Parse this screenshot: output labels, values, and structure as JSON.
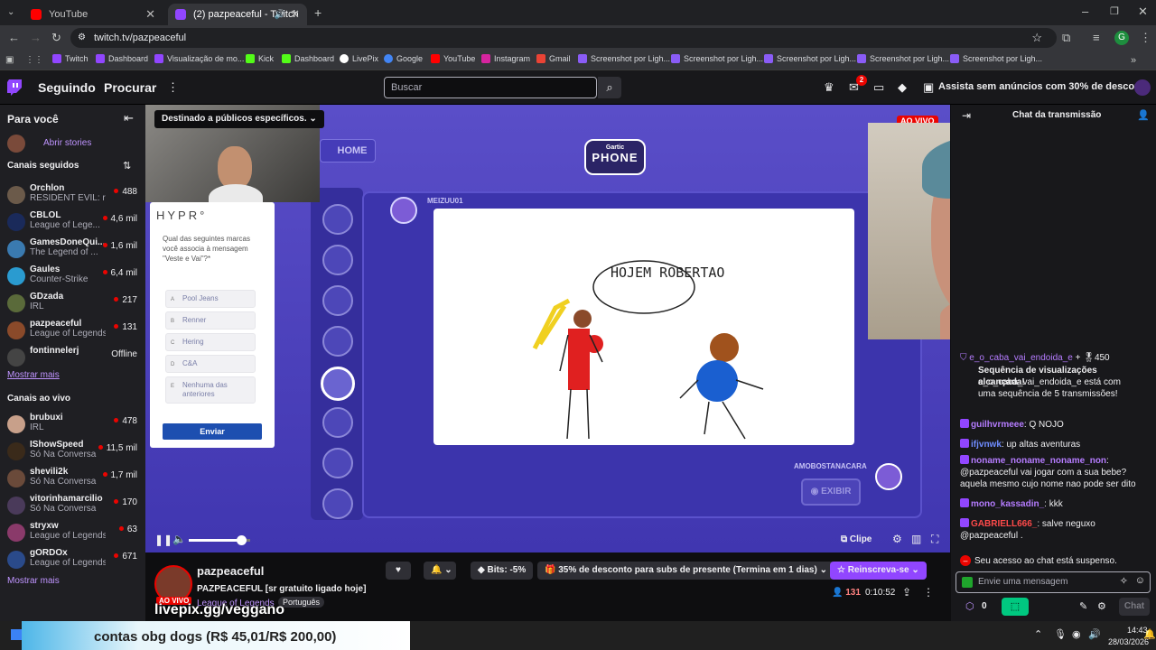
{
  "browser": {
    "tabs": [
      {
        "title": "YouTube",
        "color": "#ff0000"
      },
      {
        "title": "(2) pazpeaceful - Twitch",
        "color": "#9146ff"
      }
    ],
    "url": "twitch.tv/pazpeaceful",
    "profile_initial": "G",
    "bookmarks": [
      "Twitch",
      "Dashboard",
      "Visualização de mo...",
      "Kick",
      "Dashboard",
      "LivePix",
      "Google",
      "YouTube",
      "Instagram",
      "Gmail",
      "Screenshot por Ligh...",
      "Screenshot por Ligh...",
      "Screenshot por Ligh...",
      "Screenshot por Ligh...",
      "Screenshot por Ligh..."
    ]
  },
  "topnav": {
    "following": "Seguindo",
    "browse": "Procurar",
    "search_placeholder": "Buscar",
    "notif_count": "2",
    "prime_text": "Assista sem anúncios com 30% de desconto"
  },
  "sidebar": {
    "for_you": "Para você",
    "stories": "Abrir stories",
    "followed_title": "Canais seguidos",
    "followed": [
      {
        "name": "Orchlon",
        "game": "RESIDENT EVIL: r...",
        "viewers": "488",
        "color": "#6b5a4a"
      },
      {
        "name": "CBLOL",
        "game": "League of Lege...",
        "viewers": "4,6 mil",
        "color": "#1a2a5a"
      },
      {
        "name": "GamesDoneQui...",
        "game": "The Legend of ...",
        "viewers": "1,6 mil",
        "color": "#3a7ab0"
      },
      {
        "name": "Gaules",
        "game": "Counter-Strike",
        "viewers": "6,4 mil",
        "color": "#2a9bd0"
      },
      {
        "name": "GDzada",
        "game": "IRL",
        "viewers": "217",
        "color": "#5a6a3a"
      },
      {
        "name": "pazpeaceful",
        "game": "League of Legends",
        "viewers": "131",
        "color": "#8a4a2a"
      },
      {
        "name": "fontinnelerj",
        "game": "",
        "viewers": "Offline",
        "color": "#444444"
      }
    ],
    "show_more": "Mostrar mais",
    "live_title": "Canais ao vivo",
    "live": [
      {
        "name": "brubuxi",
        "game": "IRL",
        "viewers": "478",
        "color": "#c8a08a"
      },
      {
        "name": "IShowSpeed",
        "game": "Só Na Conversa",
        "viewers": "11,5 mil",
        "color": "#3a2a1a"
      },
      {
        "name": "shevili2k",
        "game": "Só Na Conversa",
        "viewers": "1,7 mil",
        "color": "#6a4a3a"
      },
      {
        "name": "vitorinhamarcilio",
        "game": "Só Na Conversa",
        "viewers": "170",
        "color": "#4a3a5a"
      },
      {
        "name": "stryxw",
        "game": "League of Legends",
        "viewers": "63",
        "color": "#8a3a6a"
      },
      {
        "name": "gORDOx",
        "game": "League of Legends",
        "viewers": "671",
        "color": "#2a4a8a"
      }
    ],
    "show_more2": "Mostrar mais"
  },
  "video": {
    "audience_label": "Destinado a públicos específicos.",
    "live_badge": "AO VIVO",
    "home_button": "HOME",
    "game_logo_top": "Gartic",
    "game_logo": "PHONE",
    "drawer_name": "MEIZUU01",
    "drawing_text": "HOJEM ROBERTAO",
    "next_player": "AMOBOSTANACARA",
    "show_button": "EXIBIR",
    "survey": {
      "brand": "HYPR°",
      "question": "Qual das seguintes marcas você associa à mensagem \"Veste e Vai\"?*",
      "options": [
        {
          "key": "A",
          "label": "Pool Jeans"
        },
        {
          "key": "B",
          "label": "Renner"
        },
        {
          "key": "C",
          "label": "Hering"
        },
        {
          "key": "D",
          "label": "C&A"
        },
        {
          "key": "E",
          "label": "Nenhuma das anteriores"
        }
      ],
      "submit": "Enviar"
    },
    "volume_fraction": 0.85,
    "clip_label": "Clipe"
  },
  "stream_info": {
    "channel": "pazpeaceful",
    "title": "PAZPEACEFUL [sr gratuito ligado hoje]",
    "category": "League of Legends",
    "tag": "Português",
    "live_badge": "AO VIVO",
    "bits": "Bits: -5%",
    "sub_promo": "35% de desconto para subs de presente (Termina em 1 dias)",
    "resub": "Reinscreva-se",
    "viewers": "131",
    "uptime": "0:10:52",
    "overlay_pix": "livepix.gg/veggano",
    "overlay_goal": "contas obg dogs (R$ 45,01/R$ 200,00)"
  },
  "chat": {
    "header": "Chat da transmissão",
    "streak": {
      "user": "e_o_caba_vai_endoida_e",
      "points": "450",
      "title": "Sequência de visualizações alcançada!",
      "body": "e_o_caba_vai_endoida_e está com uma sequência de 5 transmissões!"
    },
    "messages": [
      {
        "user": "guilhvrmeee",
        "text": ": Q NOJO",
        "color": "#b57cff"
      },
      {
        "user": "ifjvnwk",
        "text": ": up altas aventuras",
        "color": "#6f8cff"
      },
      {
        "user": "noname_noname_noname_non",
        "text": ": @pazpeaceful vai jogar com a sua bebe? aquela mesmo cujo nome nao pode ser dito",
        "color": "#b57cff"
      },
      {
        "user": "mono_kassadin_",
        "text": ": kkk",
        "color": "#b57cff"
      },
      {
        "user": "GABRIELL666_",
        "text": ": salve neguxo @pazpeaceful .",
        "color": "#ff4a4a"
      }
    ],
    "suspended": "Seu acesso ao chat está suspenso.",
    "input_placeholder": "Envie uma mensagem",
    "points": "0",
    "send_label": "Chat"
  },
  "taskbar": {
    "time": "14:43",
    "date": "28/03/2026"
  }
}
